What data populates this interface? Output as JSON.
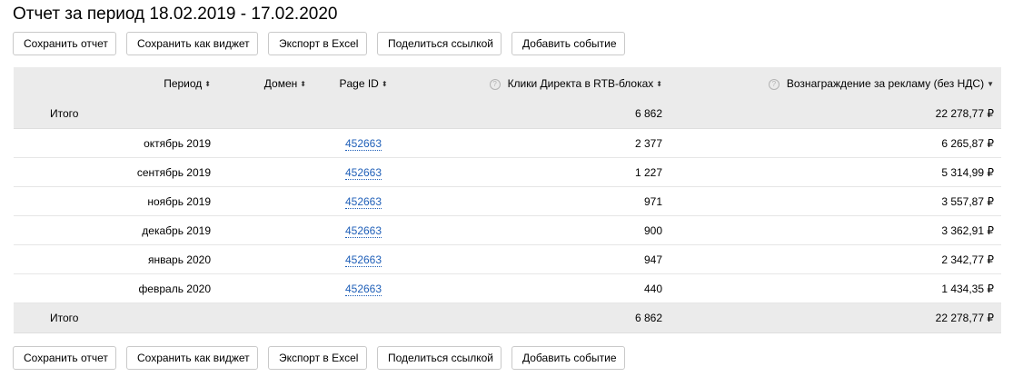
{
  "page_title": "Отчет за период 18.02.2019 - 17.02.2020",
  "toolbar": {
    "save_report": "Сохранить отчет",
    "save_as_widget": "Сохранить как виджет",
    "export_excel": "Экспорт в Excel",
    "share_link": "Поделиться ссылкой",
    "add_event": "Добавить событие"
  },
  "table": {
    "columns": {
      "period": "Период",
      "domain": "Домен",
      "page_id": "Page ID",
      "clicks": "Клики Директа в RTB-блоках",
      "reward": "Вознаграждение за рекламу (без НДС)"
    },
    "sort_icons": {
      "period": "⬍",
      "domain": "⬍",
      "page_id": "⬍",
      "clicks": "⬍",
      "reward": "▼"
    },
    "help_icon": "?",
    "total_top": {
      "label": "Итого",
      "clicks": "6 862",
      "reward": "22 278,77 ₽"
    },
    "rows": [
      {
        "period": "октябрь 2019",
        "page_id": "452663",
        "clicks": "2 377",
        "reward": "6 265,87 ₽"
      },
      {
        "period": "сентябрь 2019",
        "page_id": "452663",
        "clicks": "1 227",
        "reward": "5 314,99 ₽"
      },
      {
        "period": "ноябрь 2019",
        "page_id": "452663",
        "clicks": "971",
        "reward": "3 557,87 ₽"
      },
      {
        "period": "декабрь 2019",
        "page_id": "452663",
        "clicks": "900",
        "reward": "3 362,91 ₽"
      },
      {
        "period": "январь 2020",
        "page_id": "452663",
        "clicks": "947",
        "reward": "2 342,77 ₽"
      },
      {
        "period": "февраль 2020",
        "page_id": "452663",
        "clicks": "440",
        "reward": "1 434,35 ₽"
      }
    ],
    "total_bottom": {
      "label": "Итого",
      "clicks": "6 862",
      "reward": "22 278,77 ₽"
    }
  },
  "colors": {
    "header_bg": "#ebebeb",
    "link": "#1f5fb8",
    "border": "#c9c9c9"
  }
}
